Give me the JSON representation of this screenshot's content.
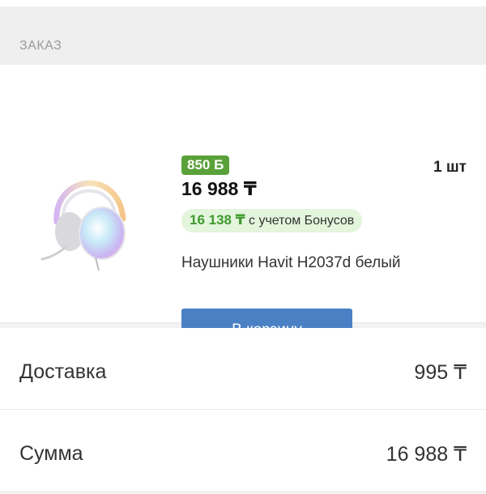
{
  "section": {
    "title": "ЗАКАЗ"
  },
  "product": {
    "bonus_badge": "850 Б",
    "price": "16 988 ₸",
    "bonus_price_value": "16 138 ₸",
    "bonus_price_text": "с учетом Бонусов",
    "quantity": "1 шт",
    "name": "Наушники Havit H2037d белый",
    "image_icon": "headphones-image",
    "add_to_cart_label": "В корзину"
  },
  "summary": {
    "delivery_label": "Доставка",
    "delivery_value": "995 ₸",
    "total_label": "Сумма",
    "total_value": "16 988 ₸"
  },
  "colors": {
    "accent_button": "#4a80c4",
    "bonus_green": "#5aa13a",
    "bonus_bg": "#e3f5dc"
  }
}
